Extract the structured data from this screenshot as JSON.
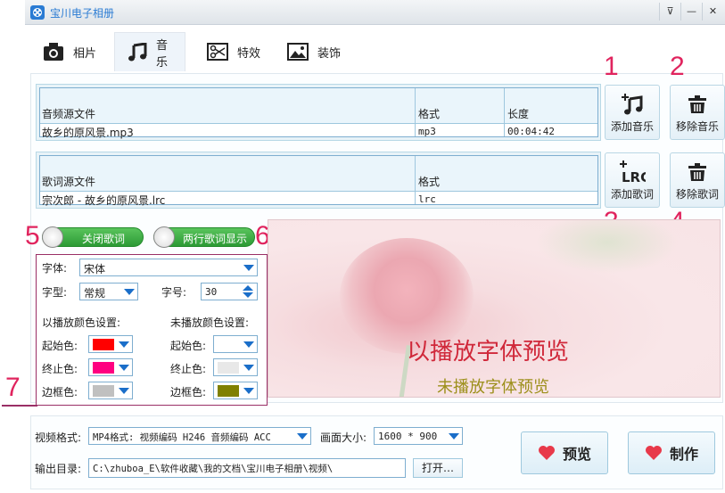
{
  "window": {
    "title": "宝川电子相册",
    "controls": [
      "⊽",
      "—",
      "✕"
    ]
  },
  "tabs": [
    {
      "label": "相片",
      "icon": "camera-icon"
    },
    {
      "label": "音乐",
      "icon": "music-note-icon"
    },
    {
      "label": "特效",
      "icon": "scissors-icon"
    },
    {
      "label": "装饰",
      "icon": "image-icon"
    }
  ],
  "music_table": {
    "headers": [
      "音频源文件",
      "格式",
      "长度"
    ],
    "rows": [
      [
        "故乡的原风景.mp3",
        "mp3",
        "00:04:42"
      ]
    ]
  },
  "lyrics_table": {
    "headers": [
      "歌词源文件",
      "格式"
    ],
    "rows": [
      [
        "宗次郎 - 故乡的原风景.lrc",
        "lrc"
      ]
    ]
  },
  "side_buttons": {
    "add_music": "添加音乐",
    "remove_music": "移除音乐",
    "add_lyrics": "添加歌词",
    "remove_lyrics": "移除歌词",
    "lrc_icon_text": "LRC"
  },
  "annotations": [
    "1",
    "2",
    "3",
    "4",
    "5",
    "6",
    "7"
  ],
  "toggles": {
    "close_lyrics": "关闭歌词",
    "two_line": "两行歌词显示"
  },
  "lyric_settings": {
    "font_label": "字体:",
    "font_value": "宋体",
    "style_label": "字型:",
    "style_value": "常规",
    "size_label": "字号:",
    "size_value": "30",
    "played_heading": "以播放颜色设置:",
    "unplayed_heading": "未播放颜色设置:",
    "start_label": "起始色:",
    "end_label": "终止色:",
    "border_label": "边框色:",
    "played_colors": {
      "start": "#ff0000",
      "end": "#ff0080",
      "border": "#c0c0c0"
    },
    "unplayed_colors": {
      "start": "#ffffff",
      "end": "#e8e8e8",
      "border": "#808000"
    }
  },
  "preview": {
    "played_text": "以播放字体预览",
    "unplayed_text": "未播放字体预览"
  },
  "bottom": {
    "video_format_label": "视频格式:",
    "video_format_value": "MP4格式: 视频编码 H246 音频编码 ACC",
    "frame_size_label": "画面大小:",
    "frame_size_value": "1600 * 900",
    "output_dir_label": "输出目录:",
    "output_dir_value": "C:\\zhuboa_E\\软件收藏\\我的文档\\宝川电子相册\\视频\\",
    "open_button": "打开…",
    "preview_button": "预览",
    "make_button": "制作"
  },
  "colors": {
    "accent": "#e0245e",
    "toggle_green": "#2c9a35",
    "heart": "#e8394a"
  }
}
